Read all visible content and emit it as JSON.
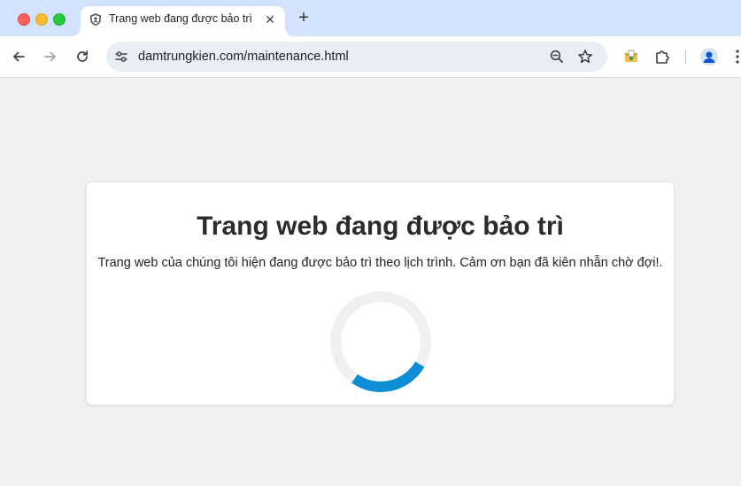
{
  "window": {
    "traffic_lights": [
      "close",
      "minimize",
      "zoom"
    ]
  },
  "tab": {
    "title": "Trang web đang được bảo trì",
    "favicon": "shield-icon",
    "close_glyph": "✕"
  },
  "toolbar": {
    "new_tab_glyph": "+",
    "url": "damtrungkien.com/maintenance.html"
  },
  "page": {
    "title": "Trang web đang được bảo trì",
    "message": "Trang web của chúng tôi hiện đang được bảo trì theo lịch trình. Cảm ơn bạn đã kiên nhẫn chờ đợi!.",
    "spinner": {
      "track_color": "#f0f0f0",
      "arc_color": "#0f8ed8"
    }
  },
  "colors": {
    "tabstrip": "#d3e3fd",
    "omnibox": "#e9eef6",
    "page_background": "#f0f1f3"
  }
}
